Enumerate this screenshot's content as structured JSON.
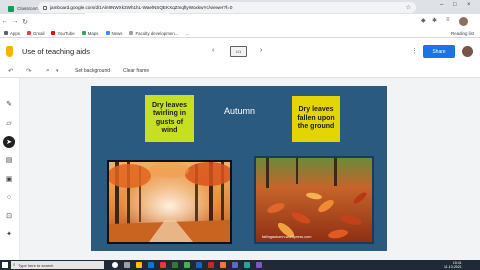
{
  "browser": {
    "tabs": [
      {
        "label": "Classroom for best 2 English Po...",
        "active": false
      },
      {
        "label": "Use of teaching aids - Google ...",
        "active": true
      }
    ],
    "new_tab": "+",
    "url": "jamboard.google.com/d/1Aln9NWXk3Wh1hL-WaelNSQEKXqZmqftyWoxkwYc/viewer?f=0",
    "bookmarks": [
      "Apps",
      "Gmail",
      "YouTube",
      "Maps",
      "News",
      "Faculty developmen...",
      "..."
    ],
    "bookmarks_right": "Reading list"
  },
  "app": {
    "title": "Use of teaching aids",
    "frame_label": "1/1",
    "share_label": "Share"
  },
  "toolbar": {
    "set_background": "Set background",
    "clear_frame": "Clear frame"
  },
  "canvas": {
    "sticky_1": "Dry leaves twirling in gusts of wind",
    "title": "Autumn",
    "sticky_2": "Dry leaves fallen upon the ground",
    "credit": "fallingautumn.wordpress.com"
  },
  "taskbar": {
    "search_placeholder": "Type here to search",
    "time": "15:41",
    "date": "11-10-2021"
  },
  "colors": {
    "frame_bg": "#2b5a80",
    "sticky_green": "#c5e021",
    "sticky_yellow": "#e4d400",
    "share_blue": "#1a73e8"
  }
}
